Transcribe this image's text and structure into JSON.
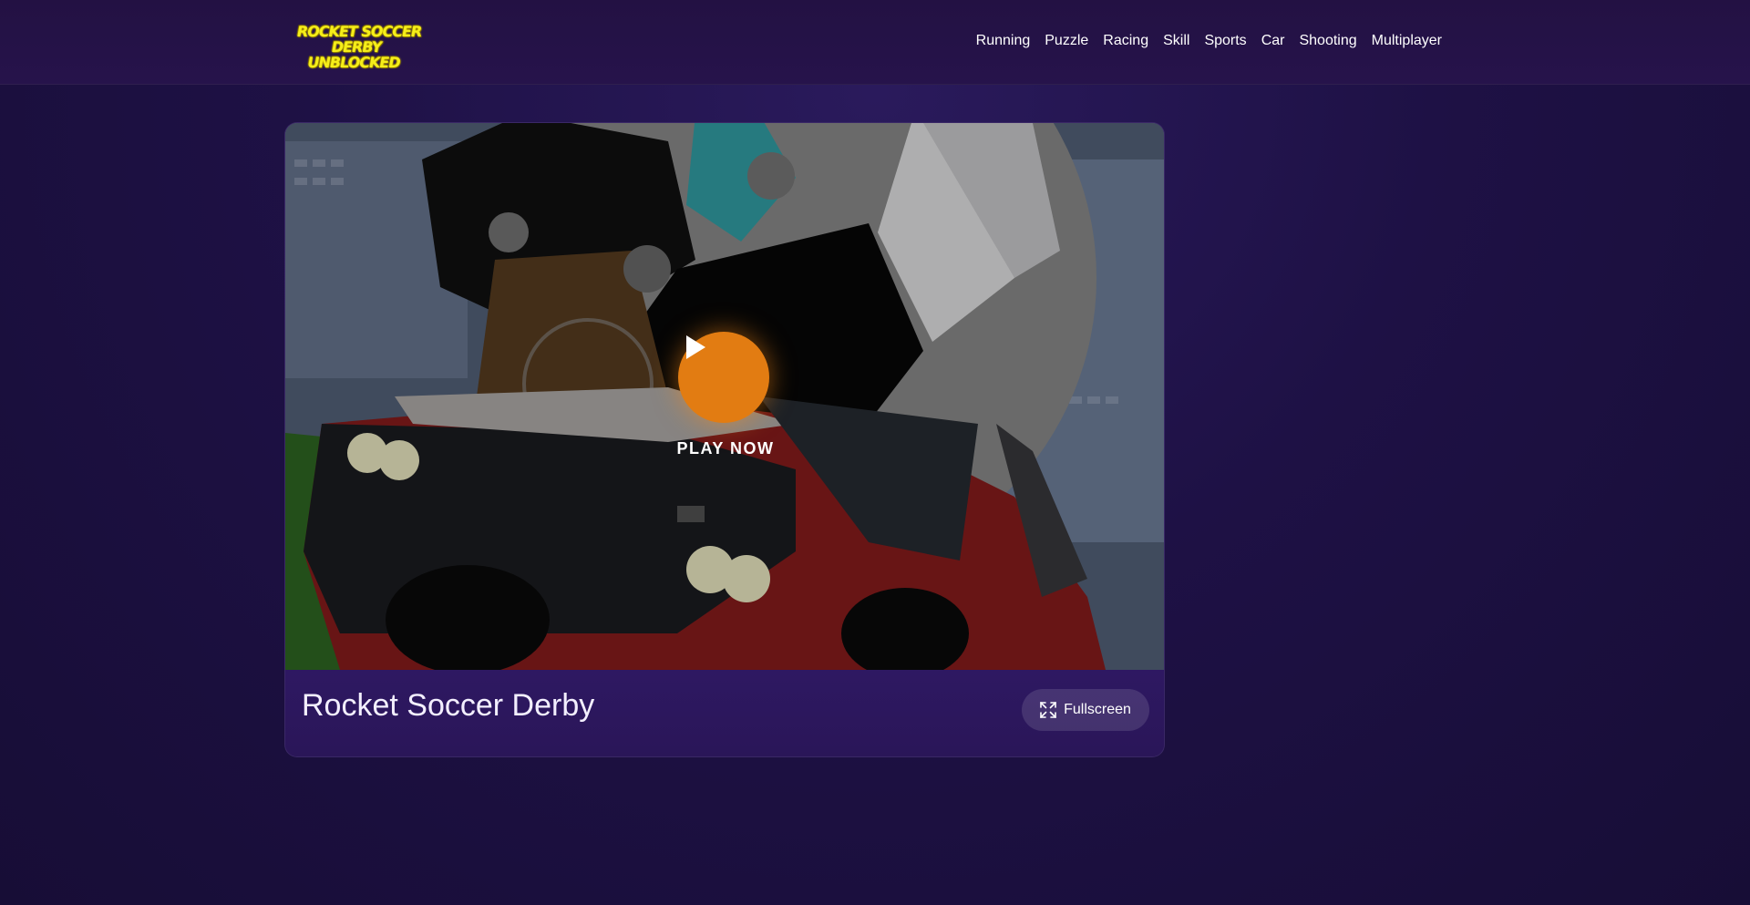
{
  "header": {
    "logo_line1": "ROCKET SOCCER DERBY",
    "logo_line2": "UNBLOCKED",
    "nav": [
      "Running",
      "Puzzle",
      "Racing",
      "Skill",
      "Sports",
      "Car",
      "Shooting",
      "Multiplayer"
    ]
  },
  "game": {
    "title": "Rocket Soccer Derby",
    "play_label": "PLAY NOW",
    "fullscreen_label": "Fullscreen",
    "play_icon": "play-icon",
    "fullscreen_icon": "expand-icon"
  },
  "colors": {
    "background": "#1e1145",
    "accent_orange": "#e27c12",
    "logo_yellow": "#f5ee1a"
  }
}
